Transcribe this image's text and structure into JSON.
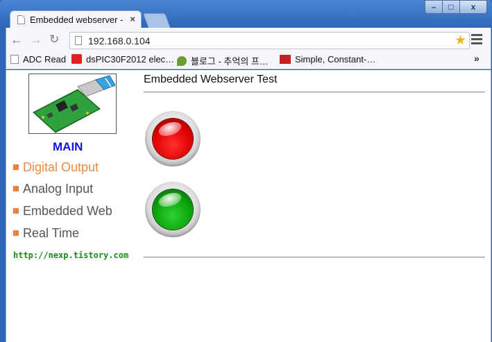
{
  "browser": {
    "tab_title": "Embedded webserver -",
    "tab_close": "×",
    "window_controls": {
      "minimize": "–",
      "maximize": "□",
      "close": "x"
    },
    "url": "192.168.0.104",
    "bookmarks": [
      {
        "label": "ADC Read",
        "icon": "page-icon"
      },
      {
        "label": "dsPIC30F2012 elec…",
        "icon": "turkey-flag-icon"
      },
      {
        "label": "블로그 - 추억의 프…",
        "icon": "leaf-icon"
      },
      {
        "label": "Simple, Constant-…",
        "icon": "pet-icon"
      }
    ],
    "bookmarks_more": "»"
  },
  "sidebar": {
    "main_label": "MAIN",
    "items": [
      {
        "label": "Digital Output",
        "active": true
      },
      {
        "label": "Analog Input",
        "active": false
      },
      {
        "label": "Embedded Web",
        "active": false
      },
      {
        "label": "Real Time",
        "active": false
      }
    ],
    "site_link": "http://nexp.tistory.com"
  },
  "content": {
    "title": "Embedded Webserver Test",
    "leds": [
      {
        "color": "red",
        "state": "on"
      },
      {
        "color": "green",
        "state": "on"
      }
    ]
  },
  "colors": {
    "main_link": "#1010e0",
    "active_item": "#f08a40",
    "site_link": "#1a8a1a",
    "led_red": "#e00000",
    "led_green": "#0aa40a"
  }
}
